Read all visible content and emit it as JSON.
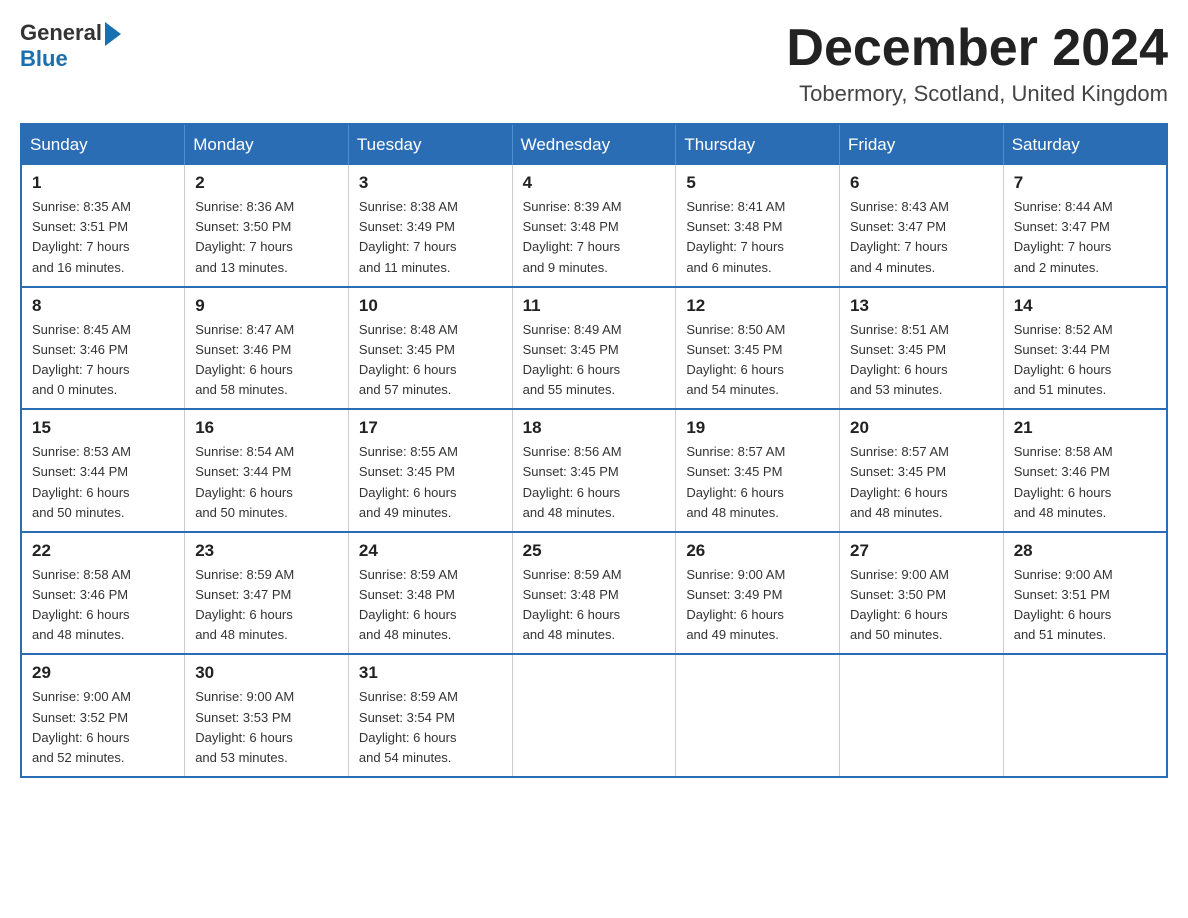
{
  "header": {
    "logo_general": "General",
    "logo_blue": "Blue",
    "month_title": "December 2024",
    "subtitle": "Tobermory, Scotland, United Kingdom"
  },
  "calendar": {
    "days_of_week": [
      "Sunday",
      "Monday",
      "Tuesday",
      "Wednesday",
      "Thursday",
      "Friday",
      "Saturday"
    ],
    "weeks": [
      [
        {
          "day": "1",
          "sunrise": "Sunrise: 8:35 AM",
          "sunset": "Sunset: 3:51 PM",
          "daylight": "Daylight: 7 hours",
          "daylight2": "and 16 minutes."
        },
        {
          "day": "2",
          "sunrise": "Sunrise: 8:36 AM",
          "sunset": "Sunset: 3:50 PM",
          "daylight": "Daylight: 7 hours",
          "daylight2": "and 13 minutes."
        },
        {
          "day": "3",
          "sunrise": "Sunrise: 8:38 AM",
          "sunset": "Sunset: 3:49 PM",
          "daylight": "Daylight: 7 hours",
          "daylight2": "and 11 minutes."
        },
        {
          "day": "4",
          "sunrise": "Sunrise: 8:39 AM",
          "sunset": "Sunset: 3:48 PM",
          "daylight": "Daylight: 7 hours",
          "daylight2": "and 9 minutes."
        },
        {
          "day": "5",
          "sunrise": "Sunrise: 8:41 AM",
          "sunset": "Sunset: 3:48 PM",
          "daylight": "Daylight: 7 hours",
          "daylight2": "and 6 minutes."
        },
        {
          "day": "6",
          "sunrise": "Sunrise: 8:43 AM",
          "sunset": "Sunset: 3:47 PM",
          "daylight": "Daylight: 7 hours",
          "daylight2": "and 4 minutes."
        },
        {
          "day": "7",
          "sunrise": "Sunrise: 8:44 AM",
          "sunset": "Sunset: 3:47 PM",
          "daylight": "Daylight: 7 hours",
          "daylight2": "and 2 minutes."
        }
      ],
      [
        {
          "day": "8",
          "sunrise": "Sunrise: 8:45 AM",
          "sunset": "Sunset: 3:46 PM",
          "daylight": "Daylight: 7 hours",
          "daylight2": "and 0 minutes."
        },
        {
          "day": "9",
          "sunrise": "Sunrise: 8:47 AM",
          "sunset": "Sunset: 3:46 PM",
          "daylight": "Daylight: 6 hours",
          "daylight2": "and 58 minutes."
        },
        {
          "day": "10",
          "sunrise": "Sunrise: 8:48 AM",
          "sunset": "Sunset: 3:45 PM",
          "daylight": "Daylight: 6 hours",
          "daylight2": "and 57 minutes."
        },
        {
          "day": "11",
          "sunrise": "Sunrise: 8:49 AM",
          "sunset": "Sunset: 3:45 PM",
          "daylight": "Daylight: 6 hours",
          "daylight2": "and 55 minutes."
        },
        {
          "day": "12",
          "sunrise": "Sunrise: 8:50 AM",
          "sunset": "Sunset: 3:45 PM",
          "daylight": "Daylight: 6 hours",
          "daylight2": "and 54 minutes."
        },
        {
          "day": "13",
          "sunrise": "Sunrise: 8:51 AM",
          "sunset": "Sunset: 3:45 PM",
          "daylight": "Daylight: 6 hours",
          "daylight2": "and 53 minutes."
        },
        {
          "day": "14",
          "sunrise": "Sunrise: 8:52 AM",
          "sunset": "Sunset: 3:44 PM",
          "daylight": "Daylight: 6 hours",
          "daylight2": "and 51 minutes."
        }
      ],
      [
        {
          "day": "15",
          "sunrise": "Sunrise: 8:53 AM",
          "sunset": "Sunset: 3:44 PM",
          "daylight": "Daylight: 6 hours",
          "daylight2": "and 50 minutes."
        },
        {
          "day": "16",
          "sunrise": "Sunrise: 8:54 AM",
          "sunset": "Sunset: 3:44 PM",
          "daylight": "Daylight: 6 hours",
          "daylight2": "and 50 minutes."
        },
        {
          "day": "17",
          "sunrise": "Sunrise: 8:55 AM",
          "sunset": "Sunset: 3:45 PM",
          "daylight": "Daylight: 6 hours",
          "daylight2": "and 49 minutes."
        },
        {
          "day": "18",
          "sunrise": "Sunrise: 8:56 AM",
          "sunset": "Sunset: 3:45 PM",
          "daylight": "Daylight: 6 hours",
          "daylight2": "and 48 minutes."
        },
        {
          "day": "19",
          "sunrise": "Sunrise: 8:57 AM",
          "sunset": "Sunset: 3:45 PM",
          "daylight": "Daylight: 6 hours",
          "daylight2": "and 48 minutes."
        },
        {
          "day": "20",
          "sunrise": "Sunrise: 8:57 AM",
          "sunset": "Sunset: 3:45 PM",
          "daylight": "Daylight: 6 hours",
          "daylight2": "and 48 minutes."
        },
        {
          "day": "21",
          "sunrise": "Sunrise: 8:58 AM",
          "sunset": "Sunset: 3:46 PM",
          "daylight": "Daylight: 6 hours",
          "daylight2": "and 48 minutes."
        }
      ],
      [
        {
          "day": "22",
          "sunrise": "Sunrise: 8:58 AM",
          "sunset": "Sunset: 3:46 PM",
          "daylight": "Daylight: 6 hours",
          "daylight2": "and 48 minutes."
        },
        {
          "day": "23",
          "sunrise": "Sunrise: 8:59 AM",
          "sunset": "Sunset: 3:47 PM",
          "daylight": "Daylight: 6 hours",
          "daylight2": "and 48 minutes."
        },
        {
          "day": "24",
          "sunrise": "Sunrise: 8:59 AM",
          "sunset": "Sunset: 3:48 PM",
          "daylight": "Daylight: 6 hours",
          "daylight2": "and 48 minutes."
        },
        {
          "day": "25",
          "sunrise": "Sunrise: 8:59 AM",
          "sunset": "Sunset: 3:48 PM",
          "daylight": "Daylight: 6 hours",
          "daylight2": "and 48 minutes."
        },
        {
          "day": "26",
          "sunrise": "Sunrise: 9:00 AM",
          "sunset": "Sunset: 3:49 PM",
          "daylight": "Daylight: 6 hours",
          "daylight2": "and 49 minutes."
        },
        {
          "day": "27",
          "sunrise": "Sunrise: 9:00 AM",
          "sunset": "Sunset: 3:50 PM",
          "daylight": "Daylight: 6 hours",
          "daylight2": "and 50 minutes."
        },
        {
          "day": "28",
          "sunrise": "Sunrise: 9:00 AM",
          "sunset": "Sunset: 3:51 PM",
          "daylight": "Daylight: 6 hours",
          "daylight2": "and 51 minutes."
        }
      ],
      [
        {
          "day": "29",
          "sunrise": "Sunrise: 9:00 AM",
          "sunset": "Sunset: 3:52 PM",
          "daylight": "Daylight: 6 hours",
          "daylight2": "and 52 minutes."
        },
        {
          "day": "30",
          "sunrise": "Sunrise: 9:00 AM",
          "sunset": "Sunset: 3:53 PM",
          "daylight": "Daylight: 6 hours",
          "daylight2": "and 53 minutes."
        },
        {
          "day": "31",
          "sunrise": "Sunrise: 8:59 AM",
          "sunset": "Sunset: 3:54 PM",
          "daylight": "Daylight: 6 hours",
          "daylight2": "and 54 minutes."
        },
        null,
        null,
        null,
        null
      ]
    ]
  }
}
